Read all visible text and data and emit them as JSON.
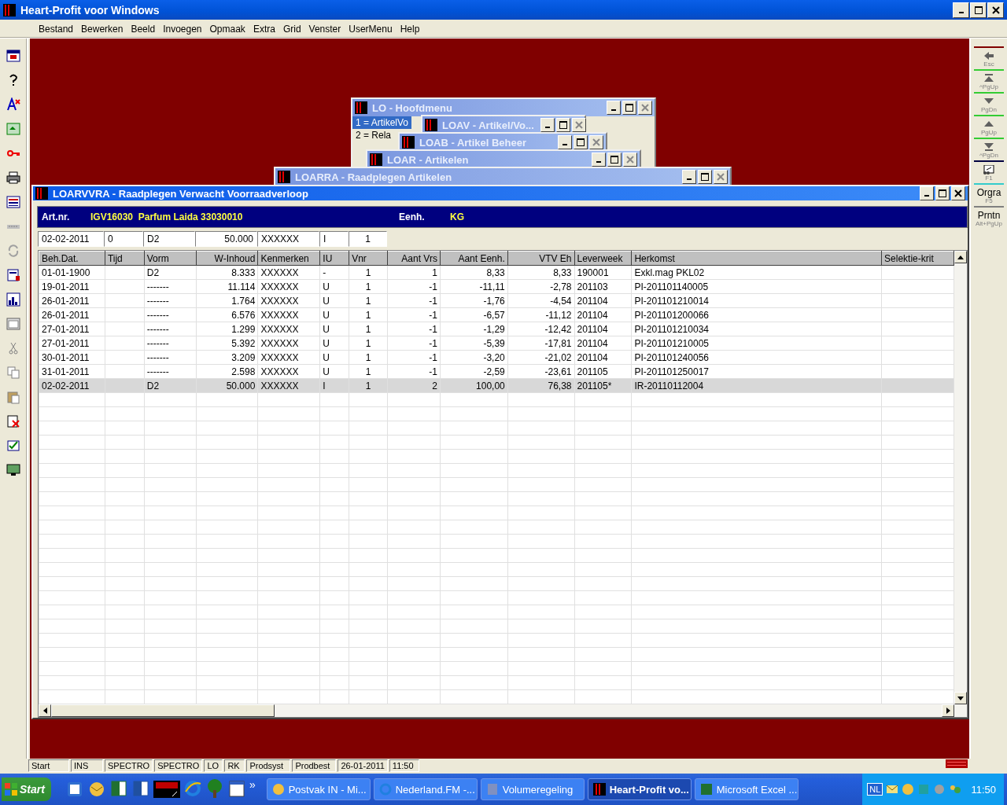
{
  "window": {
    "title": "Heart-Profit voor Windows"
  },
  "menu": [
    "Bestand",
    "Bewerken",
    "Beeld",
    "Invoegen",
    "Opmaak",
    "Extra",
    "Grid",
    "Venster",
    "UserMenu",
    "Help"
  ],
  "mdi_windows": [
    {
      "title": "LO - Hoofdmenu",
      "items": [
        {
          "label": "1 = ArtikelVo",
          "selected": true
        },
        {
          "label": "2 = Rela",
          "selected": false
        }
      ]
    },
    {
      "title": "LOAV - Artikel/Vo..."
    },
    {
      "title": "LOAB - Artikel Beheer"
    },
    {
      "title": "LOAR - Artikelen"
    },
    {
      "title": "LOARRA - Raadplegen Artikelen"
    }
  ],
  "main_window": {
    "title": "LOARVVRA - Raadplegen Verwacht Voorraadverloop",
    "header": [
      {
        "label": "Art.nr.",
        "value": "IGV16030  Parfum Laida 33030010"
      },
      {
        "label": "Eenh.",
        "value": "KG"
      }
    ],
    "edit_fields": [
      "02-02-2011",
      "0",
      "D2",
      "50.000",
      "XXXXXX",
      "I",
      "1"
    ],
    "table": {
      "columns": [
        "Beh.Dat.",
        "Tijd",
        "Vorm",
        "W-Inhoud",
        "Kenmerken",
        "IU",
        "Vnr",
        "Aant Vrs",
        "Aant Eenh.",
        "VTV Eh",
        "Leverweek",
        "Herkomst",
        "Selektie-krit"
      ],
      "rows": [
        {
          "cells": [
            "01-01-1900",
            "",
            "D2",
            "8.333",
            "XXXXXX",
            "-",
            "1",
            "1",
            "8,33",
            "8,33",
            "190001",
            "Exkl.mag PKL02",
            ""
          ],
          "selected": false
        },
        {
          "cells": [
            "19-01-2011",
            "",
            "-------",
            "11.114",
            "XXXXXX",
            "U",
            "1",
            "-1",
            "-11,11",
            "-2,78",
            "201103",
            "PI-201101140005",
            ""
          ],
          "selected": false
        },
        {
          "cells": [
            "26-01-2011",
            "",
            "-------",
            "1.764",
            "XXXXXX",
            "U",
            "1",
            "-1",
            "-1,76",
            "-4,54",
            "201104",
            "PI-201101210014",
            ""
          ],
          "selected": false
        },
        {
          "cells": [
            "26-01-2011",
            "",
            "-------",
            "6.576",
            "XXXXXX",
            "U",
            "1",
            "-1",
            "-6,57",
            "-11,12",
            "201104",
            "PI-201101200066",
            ""
          ],
          "selected": false
        },
        {
          "cells": [
            "27-01-2011",
            "",
            "-------",
            "1.299",
            "XXXXXX",
            "U",
            "1",
            "-1",
            "-1,29",
            "-12,42",
            "201104",
            "PI-201101210034",
            ""
          ],
          "selected": false
        },
        {
          "cells": [
            "27-01-2011",
            "",
            "-------",
            "5.392",
            "XXXXXX",
            "U",
            "1",
            "-1",
            "-5,39",
            "-17,81",
            "201104",
            "PI-201101210005",
            ""
          ],
          "selected": false
        },
        {
          "cells": [
            "30-01-2011",
            "",
            "-------",
            "3.209",
            "XXXXXX",
            "U",
            "1",
            "-1",
            "-3,20",
            "-21,02",
            "201104",
            "PI-201101240056",
            ""
          ],
          "selected": false
        },
        {
          "cells": [
            "31-01-2011",
            "",
            "-------",
            "2.598",
            "XXXXXX",
            "U",
            "1",
            "-1",
            "-2,59",
            "-23,61",
            "201105",
            "PI-201101250017",
            ""
          ],
          "selected": false
        },
        {
          "cells": [
            "02-02-2011",
            "",
            "D2",
            "50.000",
            "XXXXXX",
            "I",
            "1",
            "2",
            "100,00",
            "76,38",
            "201105*",
            "IR-20110112004",
            ""
          ],
          "selected": true
        }
      ]
    }
  },
  "right_toolbar": [
    {
      "kind": "back",
      "key": "Esc",
      "color": "#800000"
    },
    {
      "kind": "first",
      "key": "^PgUp",
      "color": "#33cc33"
    },
    {
      "kind": "down",
      "key": "PgDn",
      "color": "#33cc33"
    },
    {
      "kind": "up",
      "key": "PgUp",
      "color": "#33cc33"
    },
    {
      "kind": "last",
      "key": "^PgDn",
      "color": "#33cc33"
    },
    {
      "kind": "help",
      "key": "F1",
      "color": "#000040"
    },
    {
      "kind": "text",
      "label": "Orgra",
      "key": "F5",
      "color": "#33cccc"
    },
    {
      "kind": "text",
      "label": "Prntn",
      "key": "Alt+PgUp",
      "color": "#808080"
    }
  ],
  "status_bar": [
    "Start",
    "INS",
    "SPECTRO",
    "SPECTRO",
    "LO",
    "RK",
    "Prodsyst",
    "Prodbest",
    "26-01-2011",
    "11:50"
  ],
  "taskbar": {
    "start": "Start",
    "more": "»",
    "tasks": [
      {
        "label": "Postvak IN - Mi...",
        "selected": false
      },
      {
        "label": "Nederland.FM -...",
        "selected": false
      },
      {
        "label": "Volumeregeling",
        "selected": false
      },
      {
        "label": "Heart-Profit vo...",
        "selected": true
      },
      {
        "label": "Microsoft Excel ...",
        "selected": false
      }
    ],
    "language": "NL",
    "time": "11:50"
  }
}
